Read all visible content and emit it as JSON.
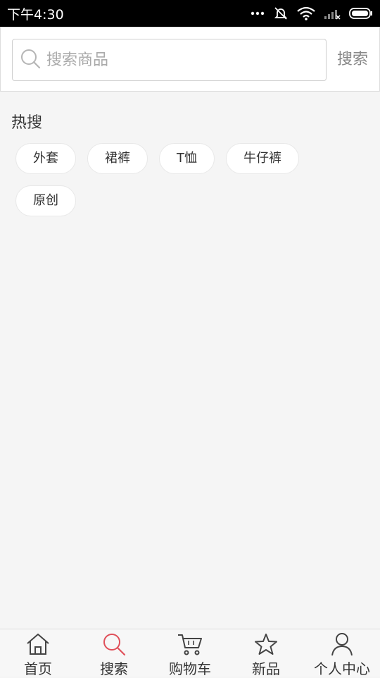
{
  "status_bar": {
    "time": "下午4:30"
  },
  "search": {
    "placeholder": "搜索商品",
    "value": "",
    "button_label": "搜索"
  },
  "hot_search": {
    "title": "热搜",
    "tags": [
      "外套",
      "裙裤",
      "T恤",
      "牛仔裤",
      "原创"
    ]
  },
  "tab_bar": {
    "items": [
      {
        "label": "首页",
        "icon": "home-icon"
      },
      {
        "label": "搜索",
        "icon": "search-icon",
        "active": true
      },
      {
        "label": "购物车",
        "icon": "cart-icon"
      },
      {
        "label": "新品",
        "icon": "star-icon"
      },
      {
        "label": "个人中心",
        "icon": "user-icon"
      }
    ]
  },
  "colors": {
    "active_icon": "#e0505a",
    "background": "#f5f5f5"
  }
}
